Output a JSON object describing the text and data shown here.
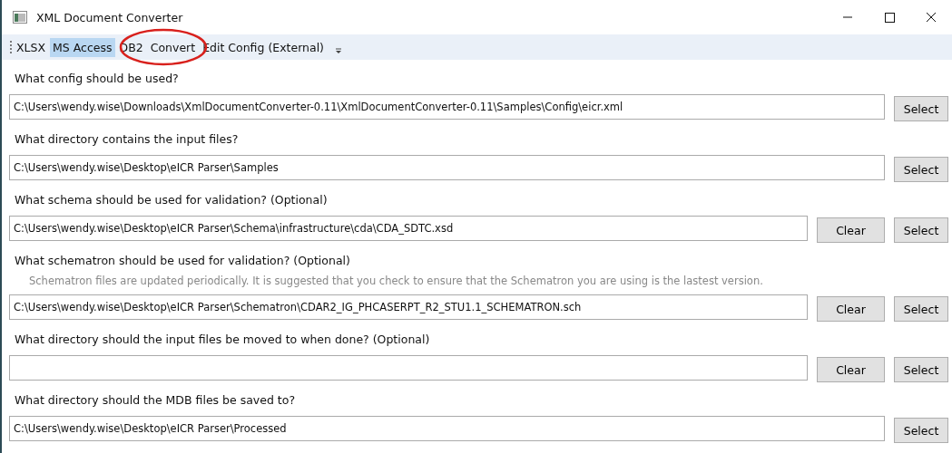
{
  "window": {
    "title": "XML Document Converter"
  },
  "toolbar": [
    {
      "label": "XLSX",
      "selected": false
    },
    {
      "label": "MS Access",
      "selected": true
    },
    {
      "label": "DB2",
      "selected": false
    },
    {
      "label": "Convert",
      "selected": false
    },
    {
      "label": "Edit Config (External)",
      "selected": false
    }
  ],
  "sections": [
    {
      "question": "What config should be used?",
      "value": "C:\\Users\\wendy.wise\\Downloads\\XmlDocumentConverter-0.11\\XmlDocumentConverter-0.11\\Samples\\Config\\eicr.xml",
      "buttons": [
        "Select"
      ]
    },
    {
      "question": "What directory contains the input files?",
      "value": "C:\\Users\\wendy.wise\\Desktop\\eICR Parser\\Samples",
      "buttons": [
        "Select"
      ]
    },
    {
      "question": "What schema should be used for validation? (Optional)",
      "value": "C:\\Users\\wendy.wise\\Desktop\\eICR Parser\\Schema\\infrastructure\\cda\\CDA_SDTC.xsd",
      "buttons": [
        "Clear",
        "Select"
      ]
    },
    {
      "question": "What schematron should be used for validation? (Optional)",
      "note": "Schematron files are updated periodically. It is suggested that you check to ensure that the Schematron you are using is the lastest version.",
      "value": "C:\\Users\\wendy.wise\\Desktop\\eICR Parser\\Schematron\\CDAR2_IG_PHCASERPT_R2_STU1.1_SCHEMATRON.sch",
      "buttons": [
        "Clear",
        "Select"
      ]
    },
    {
      "question": "What directory should the input files be moved to when done? (Optional)",
      "buttons": [
        "Clear",
        "Select"
      ]
    },
    {
      "question": "What directory should the MDB files be saved to?",
      "value": "C:\\Users\\wendy.wise\\Desktop\\eICR Parser\\Processed",
      "buttons": [
        "Select"
      ]
    }
  ]
}
